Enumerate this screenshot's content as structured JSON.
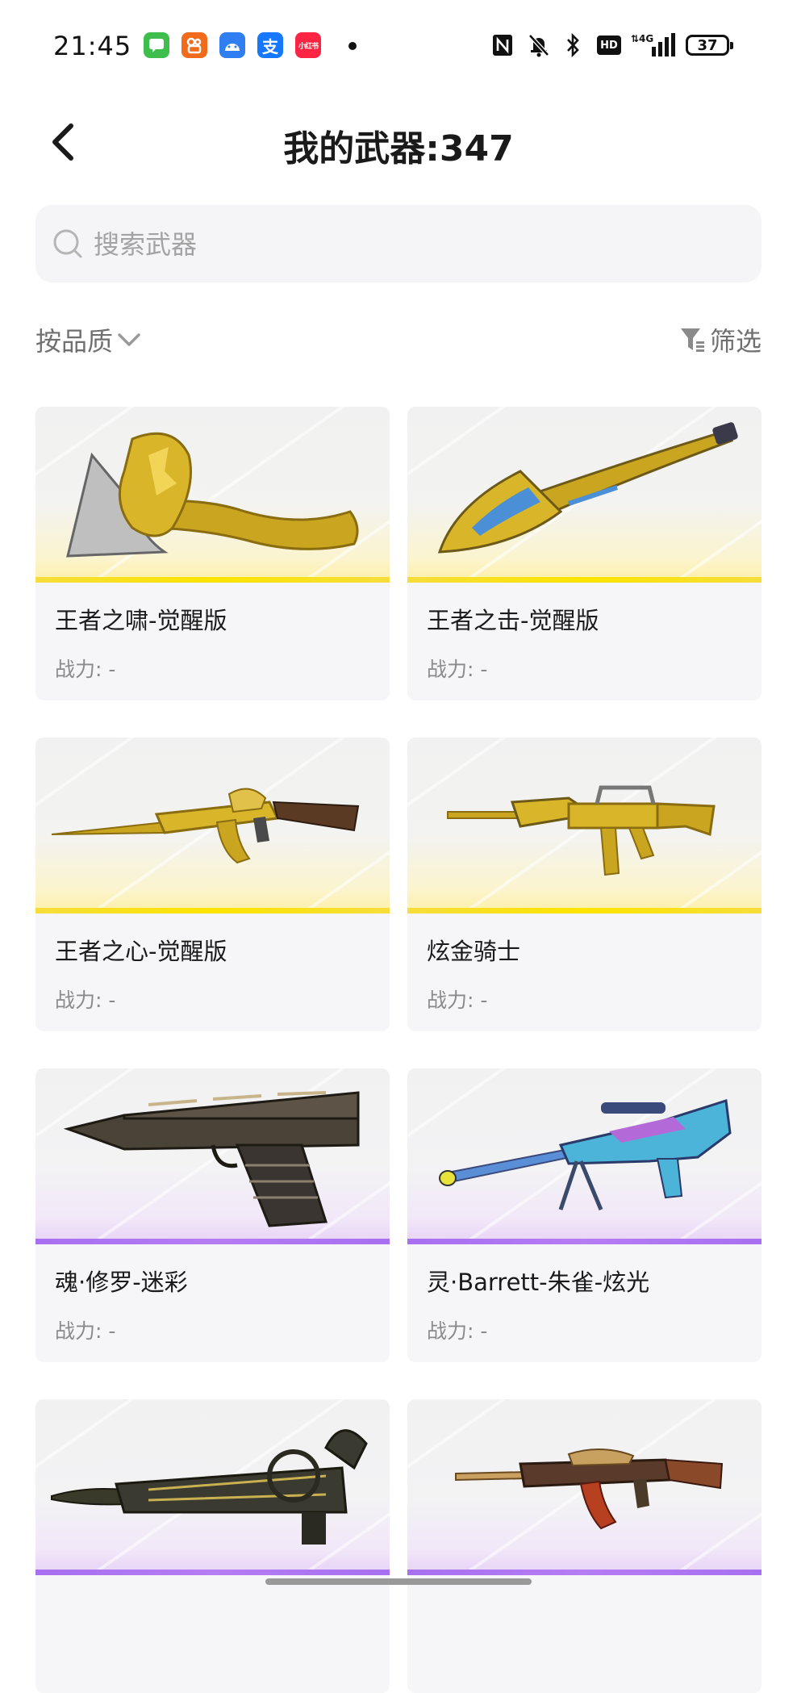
{
  "status_bar": {
    "time": "21:45",
    "app_icons": [
      {
        "name": "message-app-icon",
        "glyph": "▪",
        "color": "#3fbe4e"
      },
      {
        "name": "kuaishou-app-icon",
        "glyph": "◎",
        "color": "#f26a1c"
      },
      {
        "name": "android-app-icon",
        "glyph": "◆",
        "color": "#2f7ef2"
      },
      {
        "name": "alipay-app-icon",
        "glyph": "支",
        "color": "#1677ff"
      },
      {
        "name": "xiaohongshu-app-icon",
        "glyph": "小红书",
        "color": "#ff2442"
      }
    ],
    "network": "4G",
    "hd_label": "HD",
    "battery": "37"
  },
  "header": {
    "title": "我的武器:347"
  },
  "search": {
    "placeholder": "搜索武器",
    "value": ""
  },
  "filters": {
    "sort_label": "按品质",
    "filter_label": "筛选"
  },
  "weapons": [
    {
      "name": "王者之啸-觉醒版",
      "power": "战力: -",
      "quality": "gold",
      "icon": "axe-weapon-icon"
    },
    {
      "name": "王者之击-觉醒版",
      "power": "战力: -",
      "quality": "gold",
      "icon": "spade-weapon-icon"
    },
    {
      "name": "王者之心-觉醒版",
      "power": "战力: -",
      "quality": "gold",
      "icon": "ak-rifle-weapon-icon"
    },
    {
      "name": "炫金骑士",
      "power": "战力: -",
      "quality": "gold",
      "icon": "m4-rifle-weapon-icon"
    },
    {
      "name": "魂·修罗-迷彩",
      "power": "战力: -",
      "quality": "purple",
      "icon": "desert-eagle-weapon-icon"
    },
    {
      "name": "灵·Barrett-朱雀-炫光",
      "power": "战力: -",
      "quality": "purple",
      "icon": "barrett-sniper-weapon-icon"
    },
    {
      "name": "",
      "power": "",
      "quality": "purple",
      "icon": "dragon-gatling-weapon-icon"
    },
    {
      "name": "",
      "power": "",
      "quality": "purple",
      "icon": "ak-rifle-weapon-icon"
    }
  ],
  "colors": {
    "gold_quality": "#ffe400",
    "purple_quality": "#b57cf3",
    "card_background": "#f6f6f8"
  }
}
